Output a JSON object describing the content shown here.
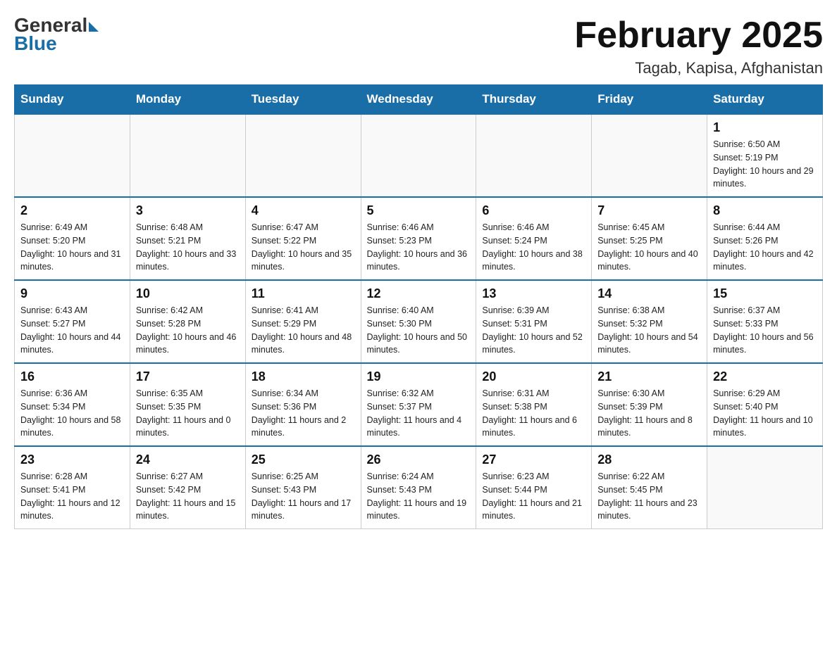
{
  "header": {
    "logo_general": "General",
    "logo_blue": "Blue",
    "month_title": "February 2025",
    "location": "Tagab, Kapisa, Afghanistan"
  },
  "days_of_week": [
    "Sunday",
    "Monday",
    "Tuesday",
    "Wednesday",
    "Thursday",
    "Friday",
    "Saturday"
  ],
  "weeks": [
    [
      {
        "day": "",
        "info": ""
      },
      {
        "day": "",
        "info": ""
      },
      {
        "day": "",
        "info": ""
      },
      {
        "day": "",
        "info": ""
      },
      {
        "day": "",
        "info": ""
      },
      {
        "day": "",
        "info": ""
      },
      {
        "day": "1",
        "info": "Sunrise: 6:50 AM\nSunset: 5:19 PM\nDaylight: 10 hours and 29 minutes."
      }
    ],
    [
      {
        "day": "2",
        "info": "Sunrise: 6:49 AM\nSunset: 5:20 PM\nDaylight: 10 hours and 31 minutes."
      },
      {
        "day": "3",
        "info": "Sunrise: 6:48 AM\nSunset: 5:21 PM\nDaylight: 10 hours and 33 minutes."
      },
      {
        "day": "4",
        "info": "Sunrise: 6:47 AM\nSunset: 5:22 PM\nDaylight: 10 hours and 35 minutes."
      },
      {
        "day": "5",
        "info": "Sunrise: 6:46 AM\nSunset: 5:23 PM\nDaylight: 10 hours and 36 minutes."
      },
      {
        "day": "6",
        "info": "Sunrise: 6:46 AM\nSunset: 5:24 PM\nDaylight: 10 hours and 38 minutes."
      },
      {
        "day": "7",
        "info": "Sunrise: 6:45 AM\nSunset: 5:25 PM\nDaylight: 10 hours and 40 minutes."
      },
      {
        "day": "8",
        "info": "Sunrise: 6:44 AM\nSunset: 5:26 PM\nDaylight: 10 hours and 42 minutes."
      }
    ],
    [
      {
        "day": "9",
        "info": "Sunrise: 6:43 AM\nSunset: 5:27 PM\nDaylight: 10 hours and 44 minutes."
      },
      {
        "day": "10",
        "info": "Sunrise: 6:42 AM\nSunset: 5:28 PM\nDaylight: 10 hours and 46 minutes."
      },
      {
        "day": "11",
        "info": "Sunrise: 6:41 AM\nSunset: 5:29 PM\nDaylight: 10 hours and 48 minutes."
      },
      {
        "day": "12",
        "info": "Sunrise: 6:40 AM\nSunset: 5:30 PM\nDaylight: 10 hours and 50 minutes."
      },
      {
        "day": "13",
        "info": "Sunrise: 6:39 AM\nSunset: 5:31 PM\nDaylight: 10 hours and 52 minutes."
      },
      {
        "day": "14",
        "info": "Sunrise: 6:38 AM\nSunset: 5:32 PM\nDaylight: 10 hours and 54 minutes."
      },
      {
        "day": "15",
        "info": "Sunrise: 6:37 AM\nSunset: 5:33 PM\nDaylight: 10 hours and 56 minutes."
      }
    ],
    [
      {
        "day": "16",
        "info": "Sunrise: 6:36 AM\nSunset: 5:34 PM\nDaylight: 10 hours and 58 minutes."
      },
      {
        "day": "17",
        "info": "Sunrise: 6:35 AM\nSunset: 5:35 PM\nDaylight: 11 hours and 0 minutes."
      },
      {
        "day": "18",
        "info": "Sunrise: 6:34 AM\nSunset: 5:36 PM\nDaylight: 11 hours and 2 minutes."
      },
      {
        "day": "19",
        "info": "Sunrise: 6:32 AM\nSunset: 5:37 PM\nDaylight: 11 hours and 4 minutes."
      },
      {
        "day": "20",
        "info": "Sunrise: 6:31 AM\nSunset: 5:38 PM\nDaylight: 11 hours and 6 minutes."
      },
      {
        "day": "21",
        "info": "Sunrise: 6:30 AM\nSunset: 5:39 PM\nDaylight: 11 hours and 8 minutes."
      },
      {
        "day": "22",
        "info": "Sunrise: 6:29 AM\nSunset: 5:40 PM\nDaylight: 11 hours and 10 minutes."
      }
    ],
    [
      {
        "day": "23",
        "info": "Sunrise: 6:28 AM\nSunset: 5:41 PM\nDaylight: 11 hours and 12 minutes."
      },
      {
        "day": "24",
        "info": "Sunrise: 6:27 AM\nSunset: 5:42 PM\nDaylight: 11 hours and 15 minutes."
      },
      {
        "day": "25",
        "info": "Sunrise: 6:25 AM\nSunset: 5:43 PM\nDaylight: 11 hours and 17 minutes."
      },
      {
        "day": "26",
        "info": "Sunrise: 6:24 AM\nSunset: 5:43 PM\nDaylight: 11 hours and 19 minutes."
      },
      {
        "day": "27",
        "info": "Sunrise: 6:23 AM\nSunset: 5:44 PM\nDaylight: 11 hours and 21 minutes."
      },
      {
        "day": "28",
        "info": "Sunrise: 6:22 AM\nSunset: 5:45 PM\nDaylight: 11 hours and 23 minutes."
      },
      {
        "day": "",
        "info": ""
      }
    ]
  ]
}
